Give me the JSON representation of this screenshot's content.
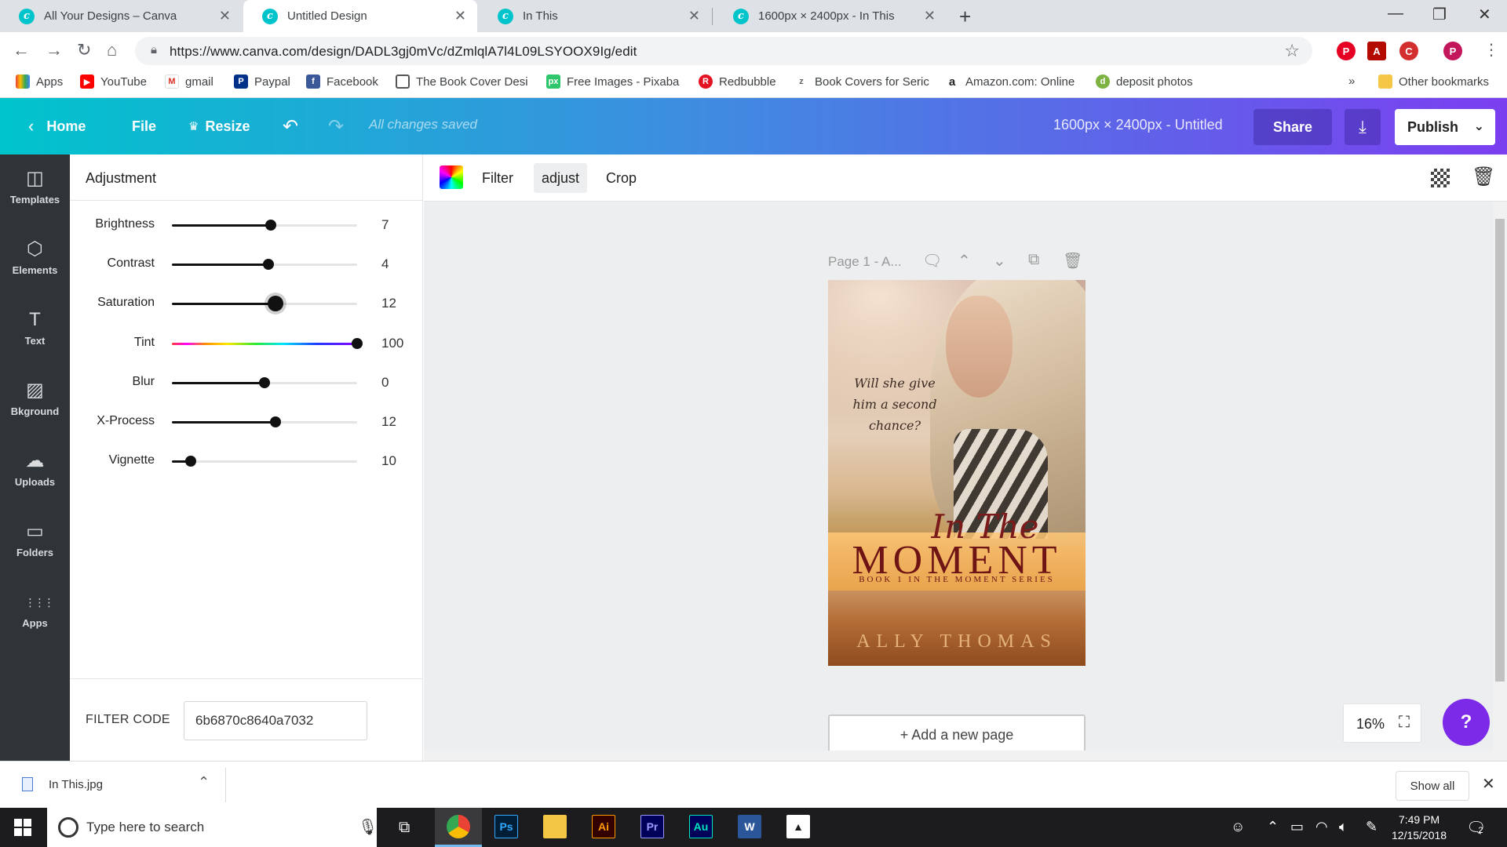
{
  "browser": {
    "tabs": [
      {
        "title": "All Your Designs – Canva",
        "active": false
      },
      {
        "title": "Untitled Design",
        "active": true
      },
      {
        "title": "In This",
        "active": false
      },
      {
        "title": "1600px × 2400px - In This",
        "active": false
      }
    ],
    "url": "https://www.canva.com/design/DADL3gj0mVc/dZmlqlA7l4L09LSYOOX9Ig/edit",
    "bookmarks": [
      {
        "label": "Apps",
        "icon": "apps-grid-icon",
        "color": "#ea4335"
      },
      {
        "label": "YouTube",
        "icon": "youtube-icon",
        "color": "#ff0000"
      },
      {
        "label": "gmail",
        "icon": "gmail-icon",
        "color": "#d93025"
      },
      {
        "label": "Paypal",
        "icon": "paypal-icon",
        "color": "#003087"
      },
      {
        "label": "Facebook",
        "icon": "facebook-icon",
        "color": "#3b5998"
      },
      {
        "label": "The Book Cover Desi",
        "icon": "book-icon",
        "color": "#555555"
      },
      {
        "label": "Free Images - Pixaba",
        "icon": "pixabay-icon",
        "color": "#2ec66d"
      },
      {
        "label": "Redbubble",
        "icon": "redbubble-icon",
        "color": "#e41321"
      },
      {
        "label": "Book Covers for Seric",
        "icon": "z-icon",
        "color": "#666666"
      },
      {
        "label": "Amazon.com: Online",
        "icon": "amazon-icon",
        "color": "#222222"
      },
      {
        "label": "deposit photos",
        "icon": "depositphotos-icon",
        "color": "#7cb342"
      }
    ],
    "bookmarks_overflow": "»",
    "other_bookmarks": "Other bookmarks"
  },
  "canva_header": {
    "home": "Home",
    "file": "File",
    "resize": "Resize",
    "status": "All changes saved",
    "title": "1600px × 2400px - Untitled",
    "share": "Share",
    "publish": "Publish"
  },
  "rail": [
    {
      "label": "Templates",
      "icon": "templates-icon",
      "glyph": "◫"
    },
    {
      "label": "Elements",
      "icon": "elements-icon",
      "glyph": "⬡"
    },
    {
      "label": "Text",
      "icon": "text-icon",
      "glyph": "T"
    },
    {
      "label": "Bkground",
      "icon": "background-icon",
      "glyph": "▨"
    },
    {
      "label": "Uploads",
      "icon": "uploads-icon",
      "glyph": "☁"
    },
    {
      "label": "Folders",
      "icon": "folder-icon",
      "glyph": "▭"
    },
    {
      "label": "Apps",
      "icon": "apps-icon",
      "glyph": "⋮⋮⋮"
    }
  ],
  "adjustment": {
    "title": "Adjustment",
    "sliders": [
      {
        "label": "Brightness",
        "value": "7",
        "position": 0.535
      },
      {
        "label": "Contrast",
        "value": "4",
        "position": 0.52
      },
      {
        "label": "Saturation",
        "value": "12",
        "position": 0.56
      },
      {
        "label": "Tint",
        "value": "100",
        "position": 1.0
      },
      {
        "label": "Blur",
        "value": "0",
        "position": 0.5
      },
      {
        "label": "X-Process",
        "value": "12",
        "position": 0.56
      },
      {
        "label": "Vignette",
        "value": "10",
        "position": 0.1
      }
    ],
    "filter_code_label": "FILTER CODE",
    "filter_code": "6b6870c8640a7032"
  },
  "toolbar": {
    "filter": "Filter",
    "adjust": "adjust",
    "crop": "Crop"
  },
  "canvas": {
    "page_label": "Page 1 - A...",
    "cover": {
      "tagline": "Will she give him a second chance?",
      "title_top": "In The",
      "title_main": "MOMENT",
      "series": "BOOK 1 IN THE MOMENT SERIES",
      "author": "ALLY THOMAS"
    },
    "add_page": "+ Add a new page",
    "zoom": "16%",
    "help": "?"
  },
  "download_shelf": {
    "file": "In This.jpg",
    "show_all": "Show all"
  },
  "taskbar": {
    "search_placeholder": "Type here to search",
    "time": "7:49 PM",
    "date": "12/15/2018",
    "notification_count": "2",
    "apps": [
      {
        "name": "chrome",
        "label": "",
        "color": "#4285f4"
      },
      {
        "name": "photoshop",
        "label": "Ps",
        "color": "#31a8ff"
      },
      {
        "name": "file-explorer",
        "label": "",
        "color": "#f3c744"
      },
      {
        "name": "illustrator",
        "label": "Ai",
        "color": "#ff9a00"
      },
      {
        "name": "premiere",
        "label": "Pr",
        "color": "#9999ff"
      },
      {
        "name": "audition",
        "label": "Au",
        "color": "#00e4bb"
      },
      {
        "name": "word",
        "label": "W",
        "color": "#2b579a"
      },
      {
        "name": "photos",
        "label": "",
        "color": "#ffffff"
      }
    ]
  }
}
